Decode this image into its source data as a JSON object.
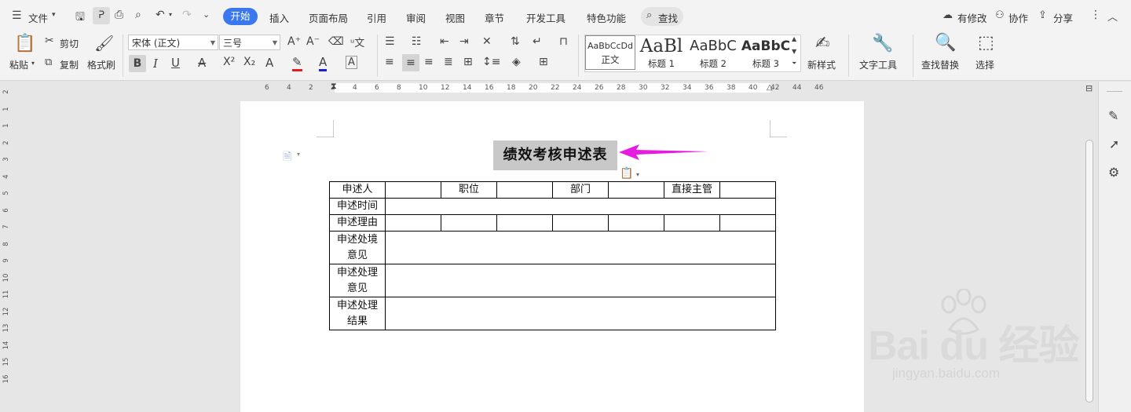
{
  "menubar": {
    "file_label": "文件",
    "tabs": [
      "开始",
      "插入",
      "页面布局",
      "引用",
      "审阅",
      "视图",
      "章节",
      "开发工具",
      "特色功能"
    ],
    "active_tab": "开始",
    "search_label": "查找",
    "right": {
      "changes": "有修改",
      "collab": "协作",
      "share": "分享"
    }
  },
  "ribbon": {
    "paste": "粘贴",
    "cut": "剪切",
    "copy": "复制",
    "format_painter": "格式刷",
    "font_name": "宋体 (正文)",
    "font_size": "三号",
    "styles": [
      {
        "sample": "AaBbCcDd",
        "caption": "正文"
      },
      {
        "sample": "AaBl",
        "caption": "标题 1"
      },
      {
        "sample": "AaBbC",
        "caption": "标题 2"
      },
      {
        "sample": "AaBbC",
        "caption": "标题 3"
      }
    ],
    "new_style": "新样式",
    "text_tools": "文字工具",
    "find_replace": "查找替换",
    "select": "选择"
  },
  "ruler": {
    "h_ticks": [
      "6",
      "4",
      "2",
      "2",
      "4",
      "6",
      "8",
      "10",
      "12",
      "14",
      "16",
      "18",
      "20",
      "22",
      "24",
      "26",
      "28",
      "30",
      "32",
      "34",
      "36",
      "38",
      "40",
      "42",
      "44",
      "46"
    ],
    "v_ticks": [
      "2",
      "1",
      "1",
      "2",
      "3",
      "4",
      "5",
      "6",
      "7",
      "8",
      "9",
      "10",
      "11",
      "12",
      "13",
      "14",
      "15",
      "16"
    ]
  },
  "document": {
    "title": "绩效考核申述表",
    "table": {
      "row1": [
        "申述人",
        "",
        "职位",
        "",
        "部门",
        "",
        "直接主管",
        ""
      ],
      "row2_label": "申述时间",
      "row3_label": "申述理由",
      "row4_label": [
        "申述处境",
        "意见"
      ],
      "row5_label": [
        "申述处理",
        "意见"
      ],
      "row6_label": [
        "申述处理",
        "结果"
      ]
    }
  },
  "watermark": {
    "brand": "Bai du 经验",
    "url": "jingyan.baidu.com"
  },
  "colors": {
    "accent": "#3a78f0",
    "arrow": "#e61de0",
    "title_highlight": "#c8c8c8"
  }
}
